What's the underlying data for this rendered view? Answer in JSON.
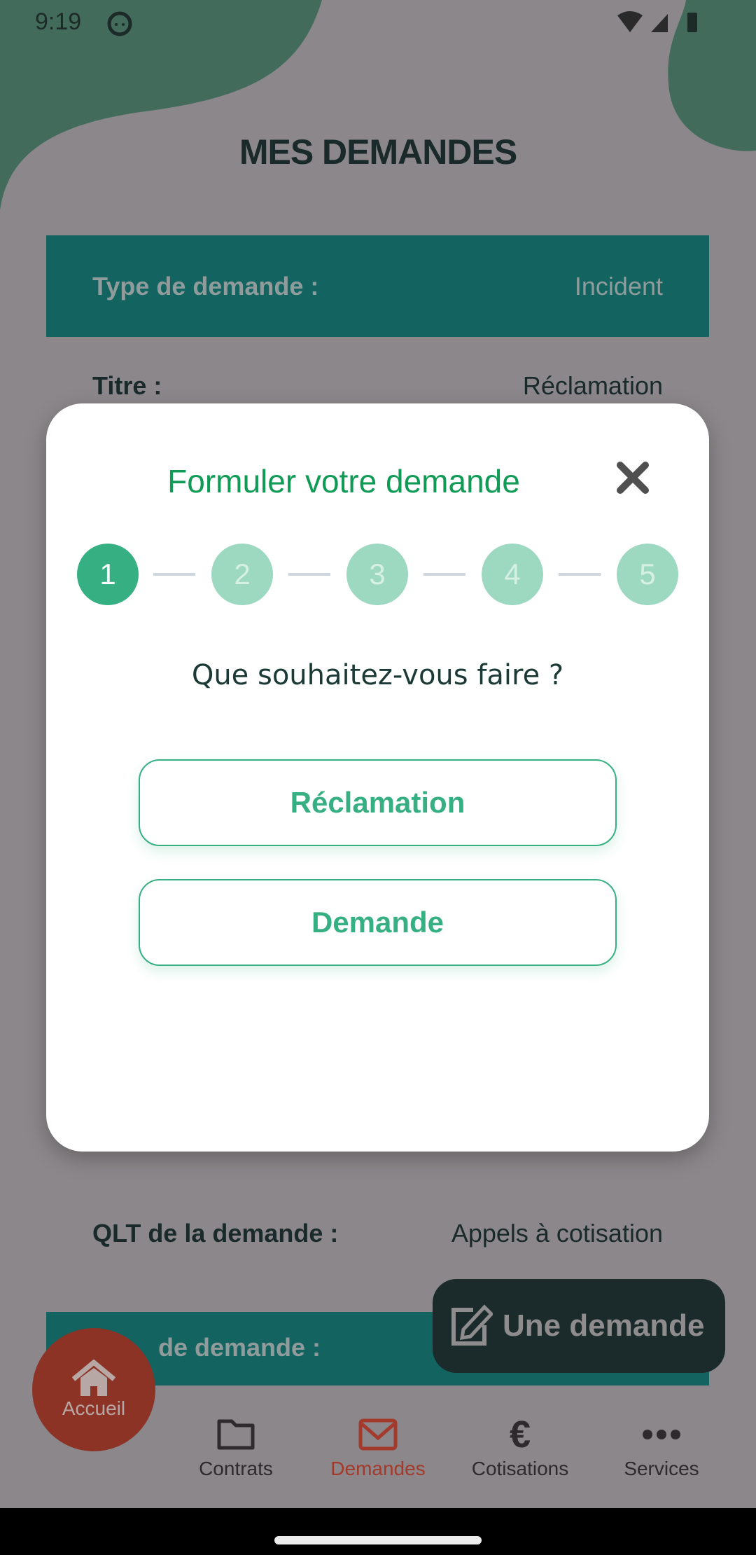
{
  "status_bar": {
    "time": "9:19",
    "icons": [
      "face-icon",
      "wifi-icon",
      "signal-icon",
      "battery-icon"
    ]
  },
  "page": {
    "title": "MES DEMANDES"
  },
  "cards": [
    {
      "type_label": "Type de demande :",
      "type_value": "Incident",
      "title_label": "Titre :",
      "title_value": "Réclamation",
      "qlt_label": "QLT de la demande :",
      "qlt_value": "Appels à cotisation"
    },
    {
      "type_label": "de demande :"
    }
  ],
  "modal": {
    "title": "Formuler votre demande",
    "steps": [
      "1",
      "2",
      "3",
      "4",
      "5"
    ],
    "current_step": 1,
    "question": "Que souhaitez-vous faire ?",
    "options": [
      "Réclamation",
      "Demande"
    ]
  },
  "fab": {
    "label": "Une demande",
    "icon": "edit-icon"
  },
  "bottom_nav": {
    "home": "Accueil",
    "items": [
      "Contrats",
      "Demandes",
      "Cotisations",
      "Services"
    ],
    "active": "Demandes"
  },
  "colors": {
    "accent": "#36b082",
    "title_green": "#0f9a55",
    "teal": "#136461",
    "active_nav": "#8c3326"
  }
}
